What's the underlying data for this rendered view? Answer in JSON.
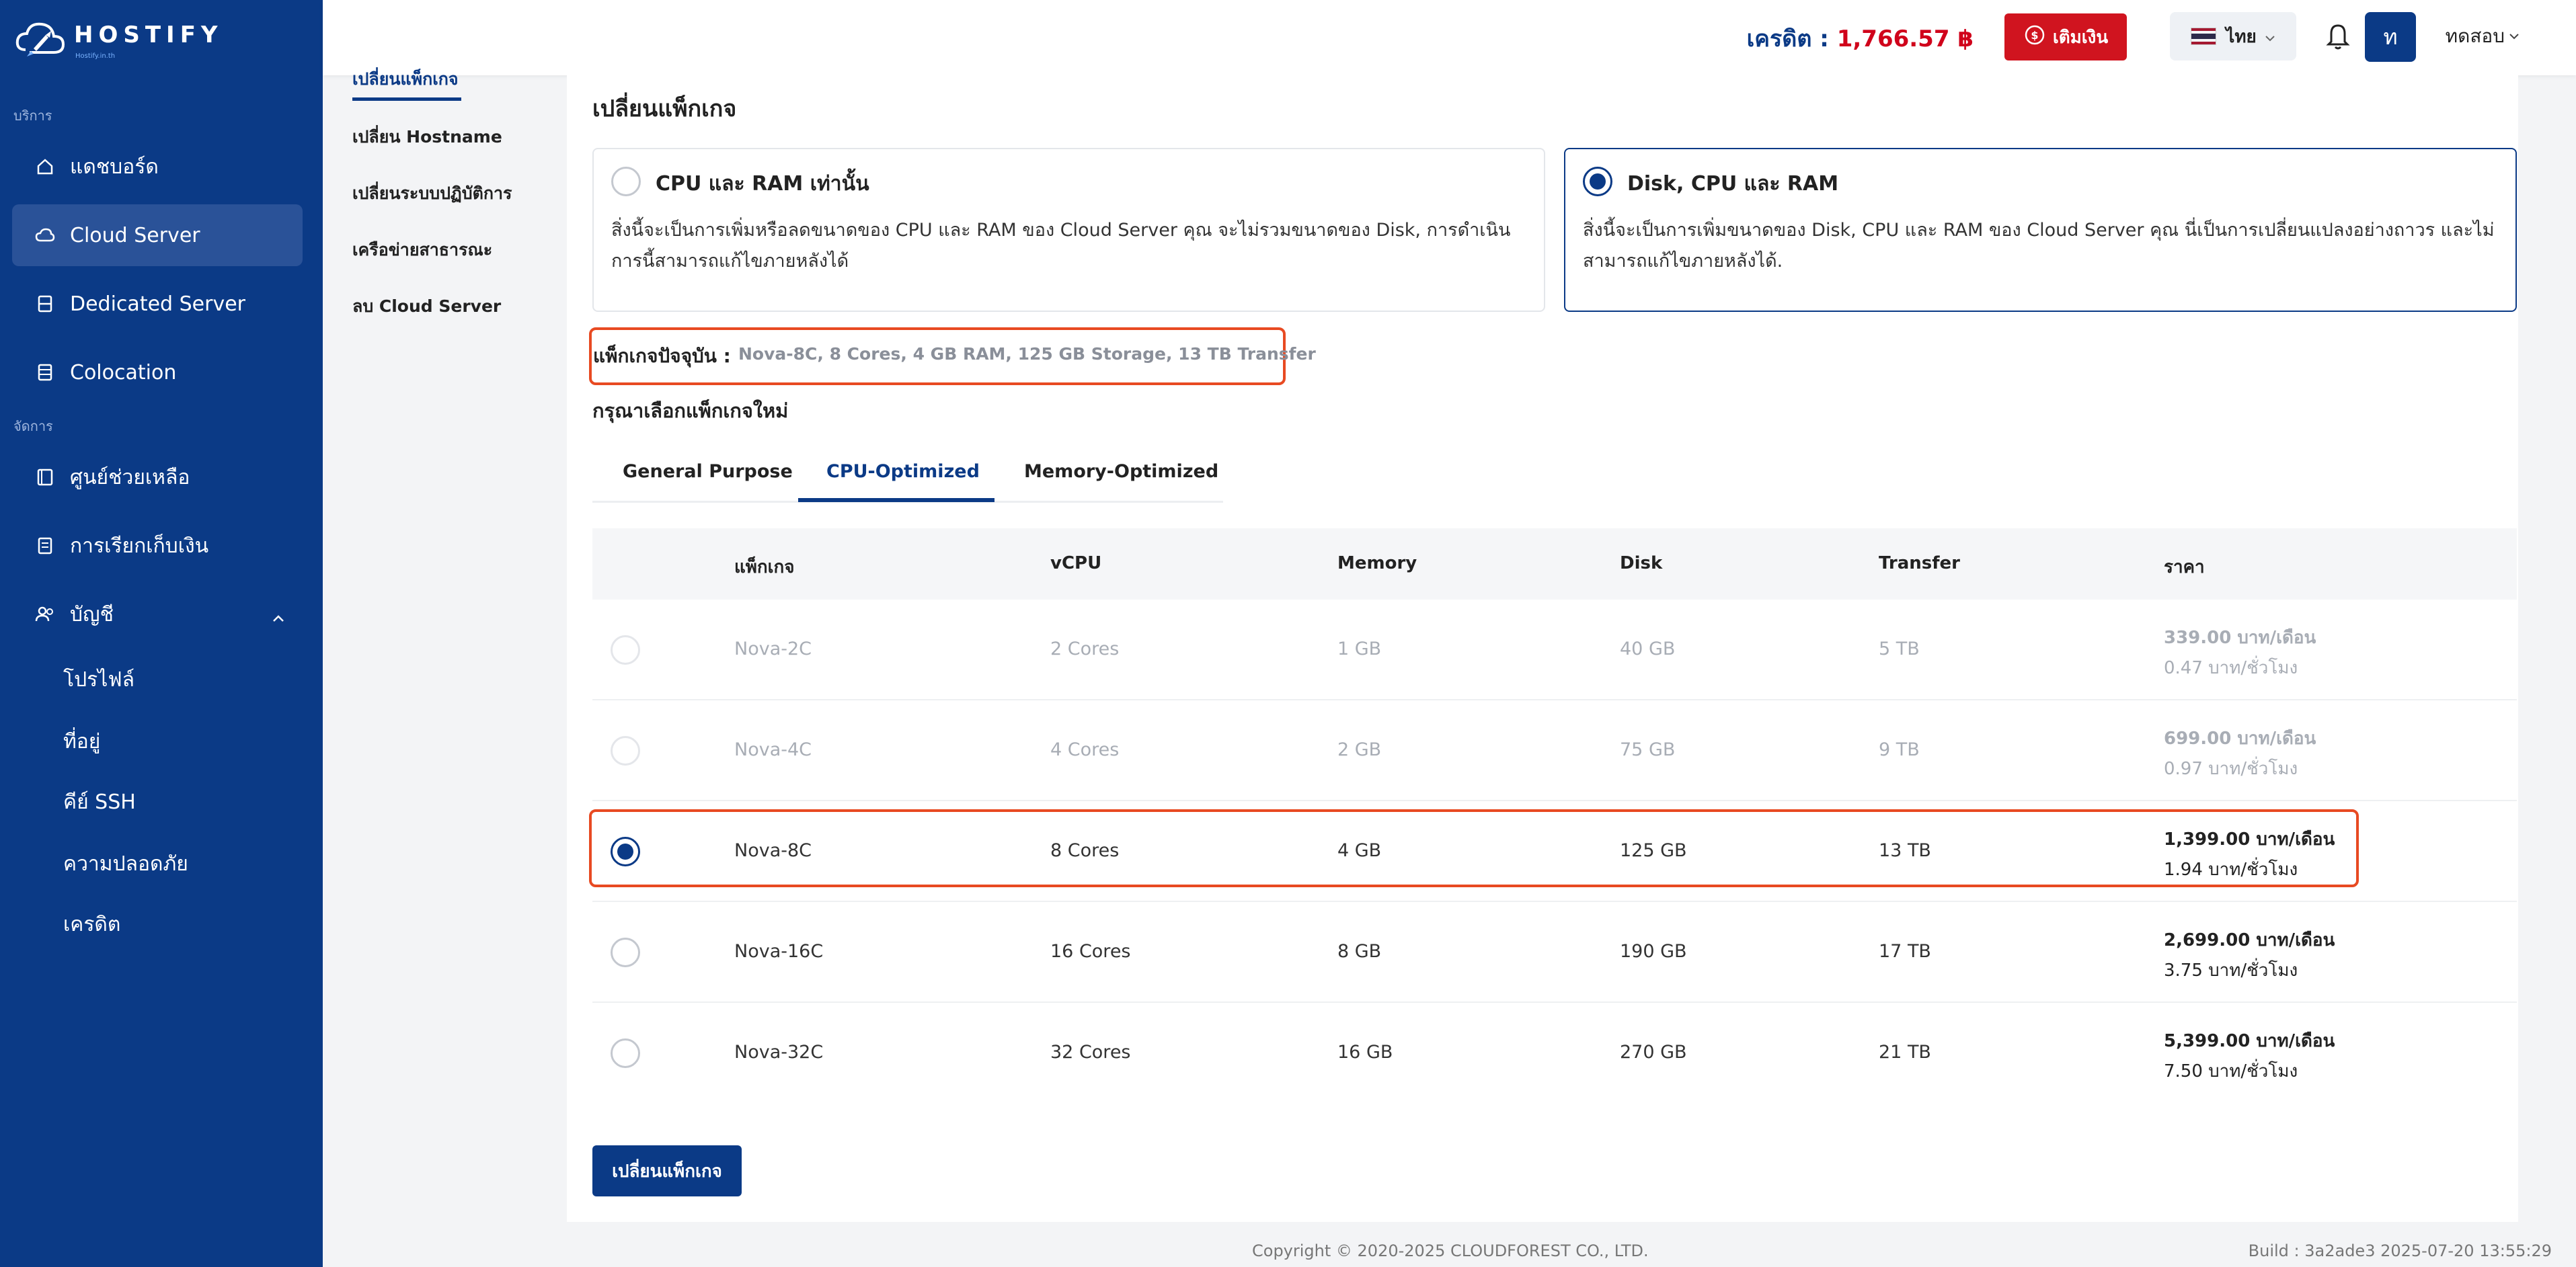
{
  "brand": {
    "name": "HOSTIFY",
    "tagline": "Hostify.in.th"
  },
  "sidebar": {
    "section_services": "บริการ",
    "section_manage": "จัดการ",
    "items": [
      {
        "label": "แดชบอร์ด",
        "icon": "home-icon"
      },
      {
        "label": "Cloud Server",
        "icon": "cloud-icon"
      },
      {
        "label": "Dedicated Server",
        "icon": "server-icon"
      },
      {
        "label": "Colocation",
        "icon": "rack-icon"
      },
      {
        "label": "ศูนย์ช่วยเหลือ",
        "icon": "help-book-icon"
      },
      {
        "label": "การเรียกเก็บเงิน",
        "icon": "billing-icon"
      },
      {
        "label": "บัญชี",
        "icon": "users-icon"
      }
    ],
    "account_sub": [
      "โปรไฟล์",
      "ที่อยู่",
      "คีย์ SSH",
      "ความปลอดภัย",
      "เครดิต"
    ]
  },
  "header": {
    "credit_label": "เครดิต :",
    "credit_amount": "1,766.57 ฿",
    "topup_label": "เติมเงิน",
    "language": "ไทย",
    "avatar_initial": "ท",
    "username": "ทดสอบ"
  },
  "subnav": [
    "เปลี่ยนแพ็กเกจ",
    "เปลี่ยน Hostname",
    "เปลี่ยนระบบปฏิบัติการ",
    "เครือข่ายสาธารณะ",
    "ลบ Cloud Server"
  ],
  "main": {
    "title": "เปลี่ยนแพ็กเกจ",
    "option_cpu_ram": {
      "title": "CPU และ RAM เท่านั้น",
      "desc": "สิ่งนี้จะเป็นการเพิ่มหรือลดขนาดของ CPU และ RAM ของ Cloud Server คุณ จะไม่รวมขนาดของ Disk, การดำเนินการนี้สามารถแก้ไขภายหลังได้"
    },
    "option_disk_cpu_ram": {
      "title": "Disk, CPU และ RAM",
      "desc": "สิ่งนี้จะเป็นการเพิ่มขนาดของ Disk, CPU และ RAM ของ Cloud Server คุณ นี่เป็นการเปลี่ยนแปลงอย่างถาวร และไม่สามารถแก้ไขภายหลังได้."
    },
    "current_package_label": "แพ็กเกจปัจจุบัน :",
    "current_package_value": "Nova-8C, 8 Cores, 4 GB RAM, 125 GB Storage, 13 TB Transfer",
    "choose_label": "กรุณาเลือกแพ็กเกจใหม่",
    "tabs": [
      "General Purpose",
      "CPU-Optimized",
      "Memory-Optimized"
    ],
    "table": {
      "headers": [
        "แพ็กเกจ",
        "vCPU",
        "Memory",
        "Disk",
        "Transfer",
        "ราคา"
      ],
      "rows": [
        {
          "name": "Nova-2C",
          "vcpu": "2 Cores",
          "memory": "1 GB",
          "disk": "40 GB",
          "transfer": "5 TB",
          "price_month": "339.00 บาท/เดือน",
          "price_hour": "0.47 บาท/ชั่วโมง"
        },
        {
          "name": "Nova-4C",
          "vcpu": "4 Cores",
          "memory": "2 GB",
          "disk": "75 GB",
          "transfer": "9 TB",
          "price_month": "699.00 บาท/เดือน",
          "price_hour": "0.97 บาท/ชั่วโมง"
        },
        {
          "name": "Nova-8C",
          "vcpu": "8 Cores",
          "memory": "4 GB",
          "disk": "125 GB",
          "transfer": "13 TB",
          "price_month": "1,399.00 บาท/เดือน",
          "price_hour": "1.94 บาท/ชั่วโมง"
        },
        {
          "name": "Nova-16C",
          "vcpu": "16 Cores",
          "memory": "8 GB",
          "disk": "190 GB",
          "transfer": "17 TB",
          "price_month": "2,699.00 บาท/เดือน",
          "price_hour": "3.75 บาท/ชั่วโมง"
        },
        {
          "name": "Nova-32C",
          "vcpu": "32 Cores",
          "memory": "16 GB",
          "disk": "270 GB",
          "transfer": "21 TB",
          "price_month": "5,399.00 บาท/เดือน",
          "price_hour": "7.50 บาท/ชั่วโมง"
        }
      ]
    },
    "submit_label": "เปลี่ยนแพ็กเกจ"
  },
  "footer": {
    "copyright": "Copyright © 2020-2025 CLOUDFOREST CO., LTD.",
    "build": "Build : 3a2ade3 2025-07-20 13:55:29"
  },
  "colors": {
    "sidebar_bg": "#0b3a86",
    "primary": "#0b3a86",
    "danger": "#d0141f",
    "highlight_outline": "#e84a22"
  }
}
